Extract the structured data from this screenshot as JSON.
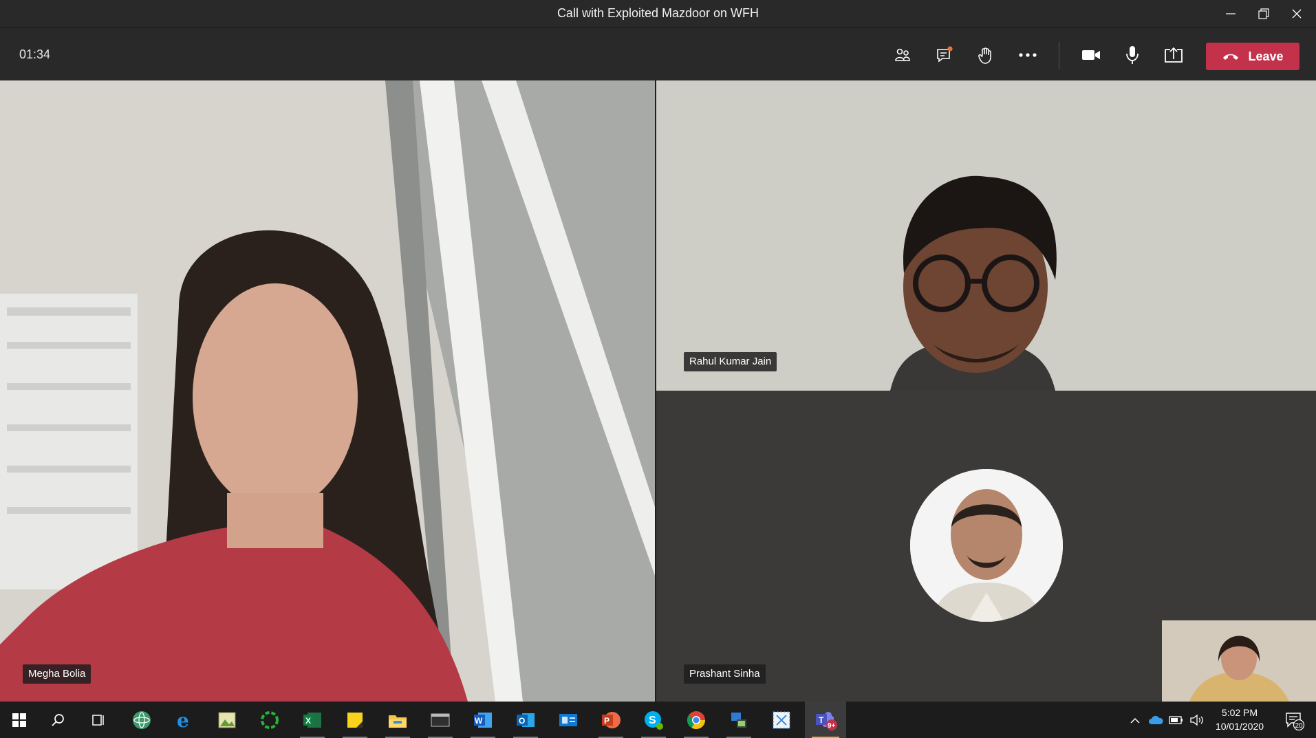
{
  "window": {
    "title": "Call with Exploited Mazdoor on WFH",
    "controls": [
      "minimize-icon",
      "restore-icon",
      "close-icon"
    ]
  },
  "toolbar": {
    "timer": "01:34",
    "buttons": [
      {
        "name": "participants-button",
        "icon": "people-icon"
      },
      {
        "name": "chat-button",
        "icon": "chat-icon",
        "badge_color": "#e3783a"
      },
      {
        "name": "raise-hand-button",
        "icon": "hand-icon"
      },
      {
        "name": "more-actions-button",
        "icon": "ellipsis-icon"
      },
      {
        "name": "camera-button",
        "icon": "video-camera-icon"
      },
      {
        "name": "mic-button",
        "icon": "microphone-icon"
      },
      {
        "name": "share-button",
        "icon": "share-tray-icon"
      }
    ],
    "leave_label": "Leave",
    "leave_color": "#c4314b"
  },
  "participants": [
    {
      "name": "Megha Bolia",
      "type": "video"
    },
    {
      "name": "Rahul Kumar Jain",
      "type": "video"
    },
    {
      "name": "Prashant Sinha",
      "type": "avatar"
    }
  ],
  "self_view": {
    "type": "video"
  },
  "taskbar": {
    "apps": [
      "windows-start-icon",
      "search-icon",
      "task-view-icon",
      "atom-app-icon",
      "internet-explorer-icon",
      "image-viewer-icon",
      "refresh-app-icon",
      "excel-icon",
      "sticky-notes-icon",
      "file-explorer-icon",
      "terminal-icon",
      "word-icon",
      "outlook-icon",
      "outlook-card-icon",
      "powerpoint-icon",
      "skype-icon",
      "chrome-icon",
      "network-app-icon",
      "snipping-icon",
      "teams-icon"
    ],
    "teams_badge": "9+",
    "time": "5:02 PM",
    "date": "10/01/2020",
    "notifications_count": "20"
  }
}
